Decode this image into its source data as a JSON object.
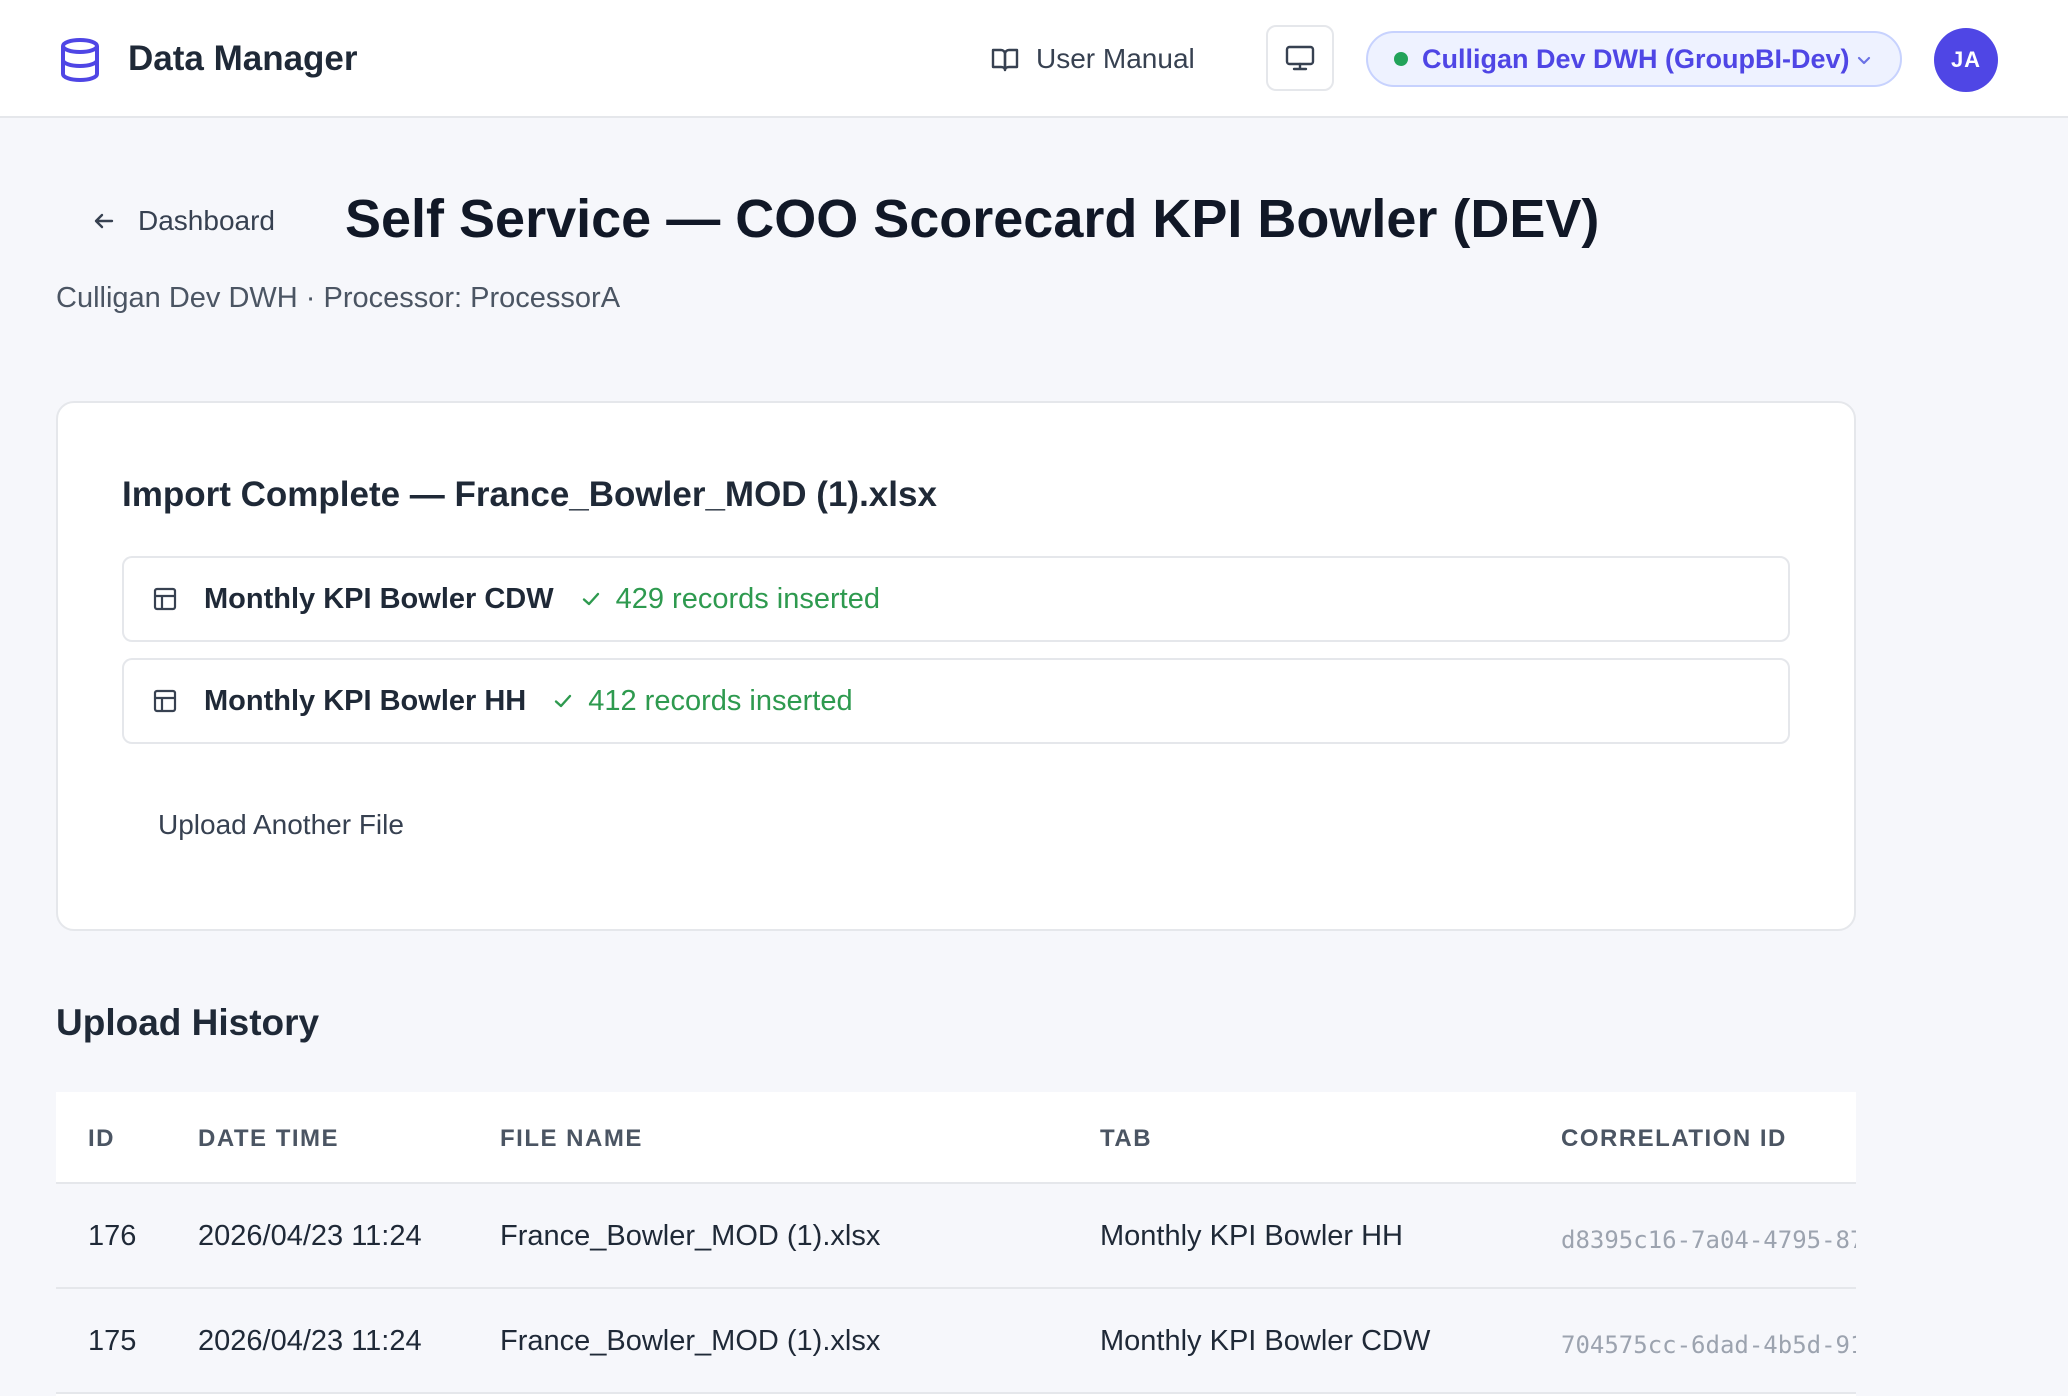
{
  "app": {
    "title": "Data Manager"
  },
  "header": {
    "manual_label": "User Manual",
    "environment": "Culligan Dev DWH (GroupBI-Dev)",
    "avatar_initials": "JA"
  },
  "page": {
    "back_label": "Dashboard",
    "title": "Self Service — COO Scorecard KPI Bowler (DEV)",
    "subtitle": "Culligan Dev DWH · Processor: ProcessorA"
  },
  "import_card": {
    "title": "Import Complete — France_Bowler_MOD (1).xlsx",
    "results": [
      {
        "tab": "Monthly KPI Bowler CDW",
        "status": "429 records inserted"
      },
      {
        "tab": "Monthly KPI Bowler HH",
        "status": "412 records inserted"
      }
    ],
    "upload_another_label": "Upload Another File"
  },
  "history": {
    "title": "Upload History",
    "columns": [
      "ID",
      "DATE TIME",
      "FILE NAME",
      "TAB",
      "CORRELATION ID"
    ],
    "rows": [
      {
        "id": "176",
        "datetime": "2026/04/23 11:24",
        "file": "France_Bowler_MOD (1).xlsx",
        "tab": "Monthly KPI Bowler HH",
        "correlation": "d8395c16-7a04-4795-87"
      },
      {
        "id": "175",
        "datetime": "2026/04/23 11:24",
        "file": "France_Bowler_MOD (1).xlsx",
        "tab": "Monthly KPI Bowler CDW",
        "correlation": "704575cc-6dad-4b5d-91"
      }
    ]
  },
  "colors": {
    "accent": "#4f46e5",
    "success": "#2e9a4f",
    "env_dot": "#22a35a"
  }
}
